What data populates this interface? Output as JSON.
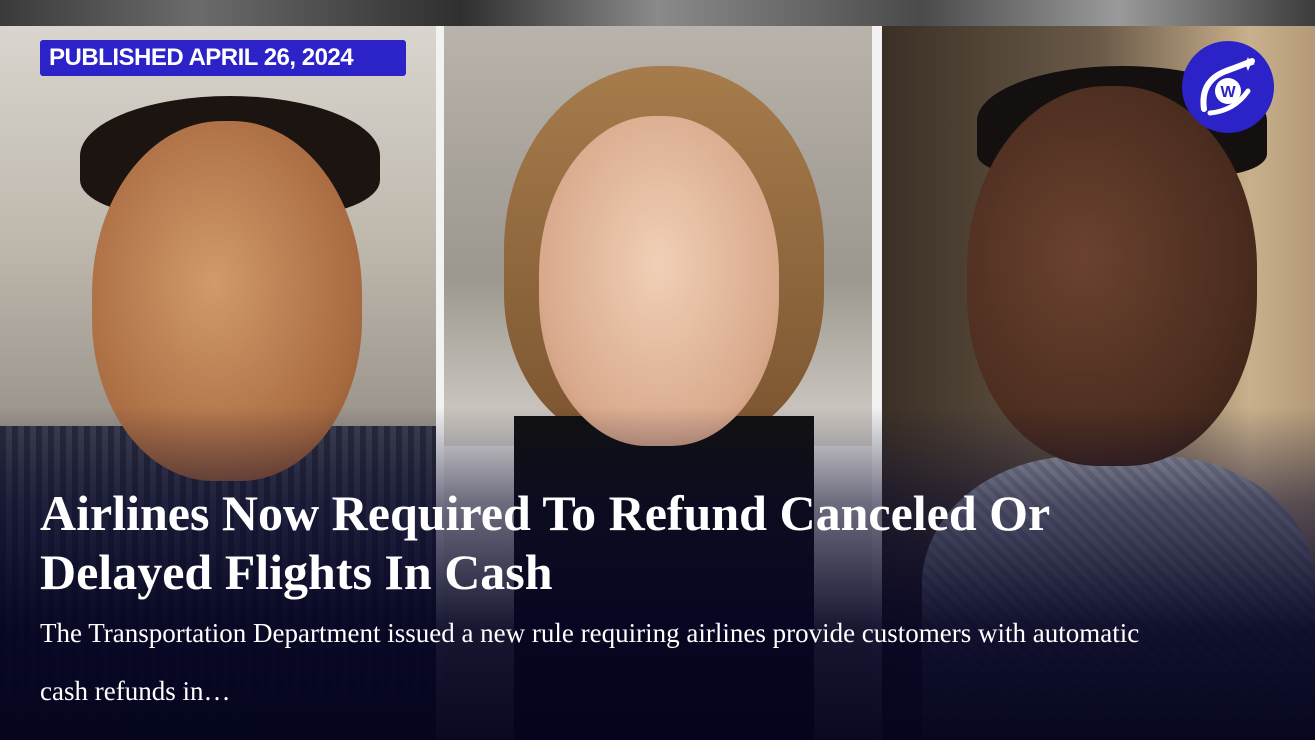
{
  "badge": {
    "label": "PUBLISHED APRIL 26, 2024"
  },
  "logo": {
    "icon": "comet-logo-icon",
    "letter": "W",
    "color": "#2b22c7"
  },
  "article": {
    "title": "Airlines Now Required To Refund Canceled Or Delayed Flights In Cash",
    "summary": "The Transportation Department issued a new rule requiring airlines provide customers with automatic cash refunds in…"
  },
  "colors": {
    "accent": "#2b22c7",
    "text": "#ffffff"
  }
}
